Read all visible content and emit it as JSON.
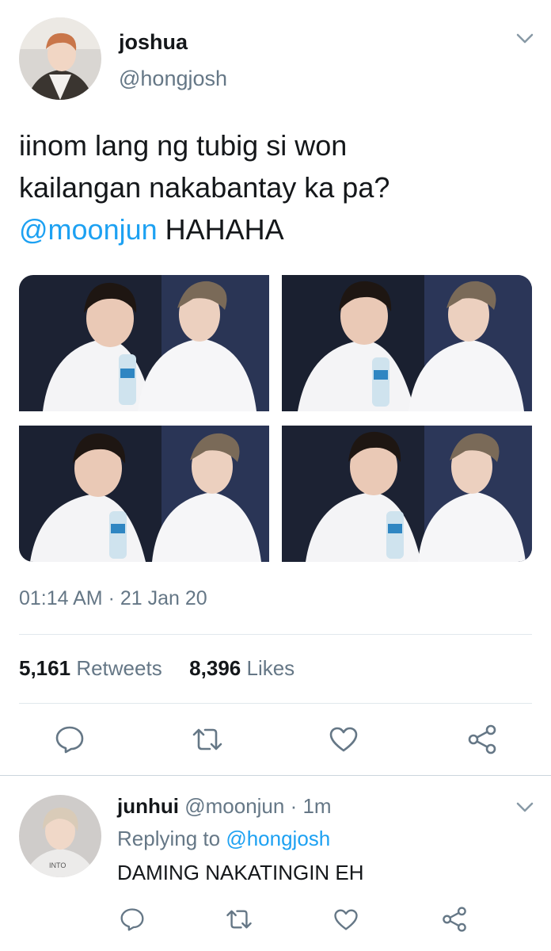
{
  "tweet": {
    "display_name": "joshua",
    "handle": "@hongjosh",
    "text_line1": "iinom lang ng tubig si won",
    "text_line2": "kailangan nakabantay ka pa?",
    "mention": "@moonjun",
    "text_suffix": " HAHAHA",
    "timestamp": "01:14 AM · 21 Jan 20",
    "retweets_count": "5,161",
    "retweets_label": "Retweets",
    "likes_count": "8,396",
    "likes_label": "Likes",
    "photo_count": 4
  },
  "reply": {
    "display_name": "junhui",
    "handle_time": "@moonjun · 1m",
    "replying_prefix": "Replying to ",
    "replying_to": "@hongjosh",
    "text": "DAMING NAKATINGIN EH"
  },
  "icons": {
    "more": "chevron-down-icon",
    "reply": "reply-icon",
    "retweet": "retweet-icon",
    "like": "heart-icon",
    "share": "share-icon"
  },
  "colors": {
    "accent": "#1da1f2",
    "secondary_text": "#657786",
    "primary_text": "#14171a",
    "divider": "#e1e8ed",
    "icon": "#657786"
  }
}
